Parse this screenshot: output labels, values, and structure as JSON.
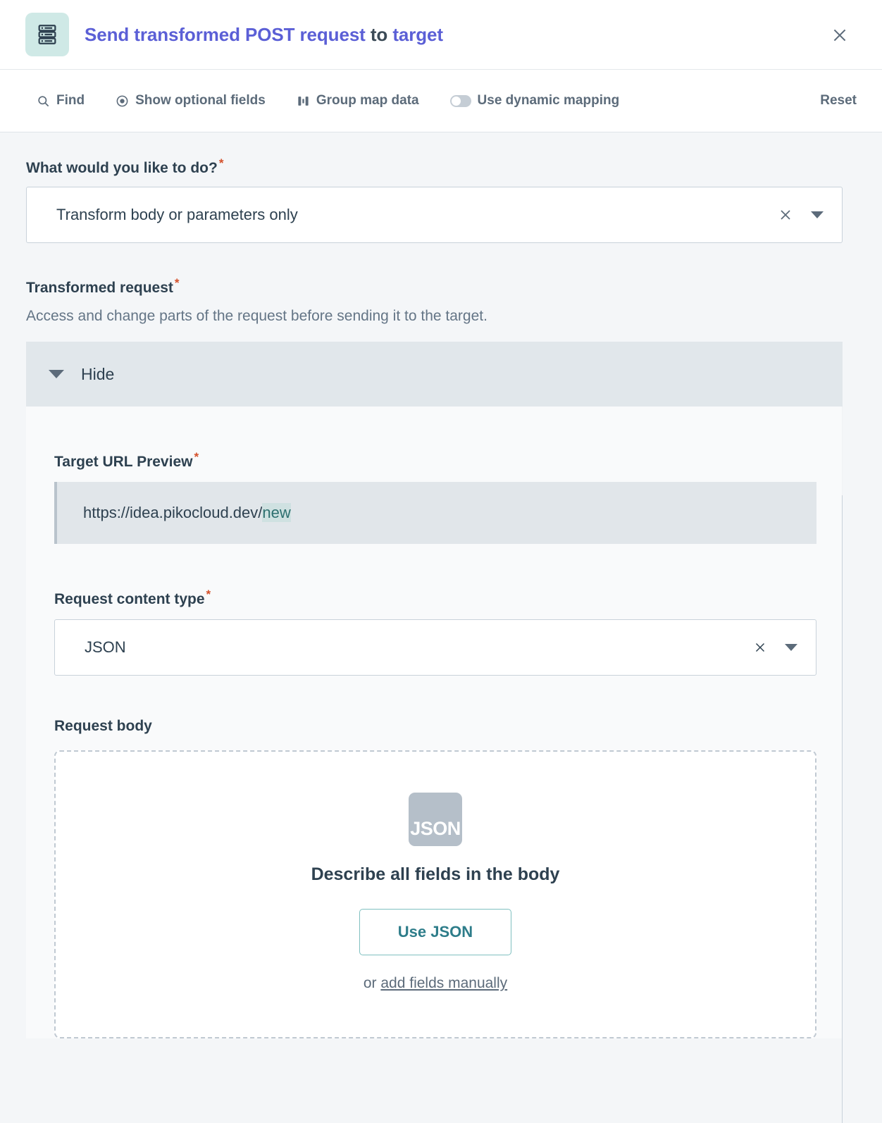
{
  "header": {
    "icon": "server-stack-icon",
    "title_parts": [
      {
        "text": "Send transformed POST request",
        "style": "accent"
      },
      {
        "text": "to",
        "style": "plain"
      },
      {
        "text": "target",
        "style": "accent"
      }
    ],
    "title_accent_1": "Send transformed POST request",
    "title_plain": "to",
    "title_accent_2": "target",
    "close_label": "close-icon",
    "accent_color": "#5b5fd6"
  },
  "toolbar": {
    "find_label": "Find",
    "show_optional_label": "Show optional fields",
    "group_map_label": "Group map data",
    "dynamic_mapping_label": "Use dynamic mapping",
    "dynamic_mapping_on": false,
    "reset_label": "Reset"
  },
  "what_to_do": {
    "label": "What would you like to do?",
    "required_marker": "*",
    "value": "Transform body or parameters only"
  },
  "transformed_request": {
    "label": "Transformed request",
    "required_marker": "*",
    "description": "Access and change parts of the request before sending it to the target.",
    "collapse_label": "Hide"
  },
  "target_url": {
    "label": "Target URL Preview",
    "required_marker": "*",
    "base": "https://idea.pikocloud.dev/",
    "token": "new"
  },
  "content_type": {
    "label": "Request content type",
    "required_marker": "*",
    "value": "JSON"
  },
  "request_body": {
    "label": "Request body",
    "badge_text": "JSON",
    "title": "Describe all fields in the body",
    "use_json_label": "Use JSON",
    "manual_prefix": "or ",
    "manual_link": "add fields manually"
  },
  "colors": {
    "accent": "#5b5fd6",
    "teal": "#2e7d8a",
    "required": "#d4502a",
    "text": "#2e4150",
    "muted": "#5c6b7a"
  }
}
